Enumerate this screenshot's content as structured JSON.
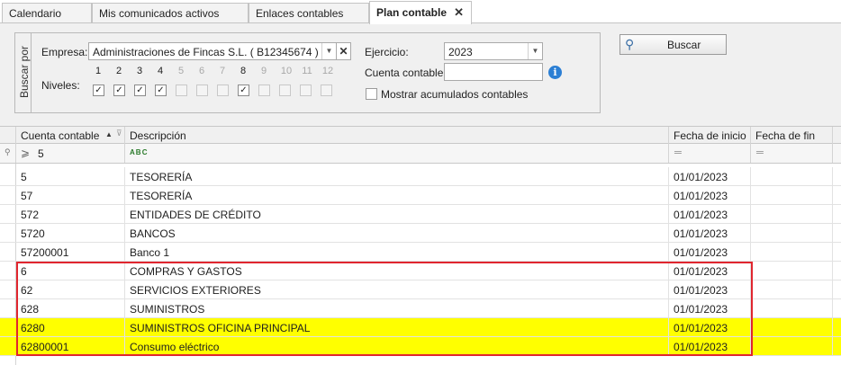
{
  "tabs": [
    {
      "label": "Calendario",
      "active": false
    },
    {
      "label": "Mis comunicados activos",
      "active": false
    },
    {
      "label": "Enlaces contables",
      "active": false
    },
    {
      "label": "Plan contable",
      "active": true
    }
  ],
  "tab_close_glyph": "✕",
  "search": {
    "group_label": "Buscar por",
    "empresa_label": "Empresa:",
    "empresa_value": "Administraciones de Fincas S.L. ( B12345674 )",
    "niveles_label": "Niveles:",
    "levels": [
      {
        "num": "1",
        "checked": true,
        "enabled": true
      },
      {
        "num": "2",
        "checked": true,
        "enabled": true
      },
      {
        "num": "3",
        "checked": true,
        "enabled": true
      },
      {
        "num": "4",
        "checked": true,
        "enabled": true
      },
      {
        "num": "5",
        "checked": false,
        "enabled": false
      },
      {
        "num": "6",
        "checked": false,
        "enabled": false
      },
      {
        "num": "7",
        "checked": false,
        "enabled": false
      },
      {
        "num": "8",
        "checked": true,
        "enabled": true
      },
      {
        "num": "9",
        "checked": false,
        "enabled": false
      },
      {
        "num": "10",
        "checked": false,
        "enabled": false
      },
      {
        "num": "11",
        "checked": false,
        "enabled": false
      },
      {
        "num": "12",
        "checked": false,
        "enabled": false
      }
    ],
    "ejercicio_label": "Ejercicio:",
    "ejercicio_value": "2023",
    "cuenta_label": "Cuenta contable:",
    "cuenta_value": "",
    "acumulados_label": "Mostrar acumulados contables",
    "acumulados_checked": false,
    "buscar_label": "Buscar"
  },
  "grid": {
    "columns": [
      "Cuenta contable",
      "Descripción",
      "Fecha de inicio",
      "Fecha de fin"
    ],
    "filter_cuenta": "5",
    "rows": [
      {
        "cuenta": "5",
        "descripcion": "TESORERÍA",
        "inicio": "01/01/2023",
        "fin": "",
        "highlight": false
      },
      {
        "cuenta": "57",
        "descripcion": "TESORERÍA",
        "inicio": "01/01/2023",
        "fin": "",
        "highlight": false
      },
      {
        "cuenta": "572",
        "descripcion": "ENTIDADES DE CRÉDITO",
        "inicio": "01/01/2023",
        "fin": "",
        "highlight": false
      },
      {
        "cuenta": "5720",
        "descripcion": "BANCOS",
        "inicio": "01/01/2023",
        "fin": "",
        "highlight": false
      },
      {
        "cuenta": "57200001",
        "descripcion": "Banco 1",
        "inicio": "01/01/2023",
        "fin": "",
        "highlight": false
      },
      {
        "cuenta": "6",
        "descripcion": "COMPRAS Y GASTOS",
        "inicio": "01/01/2023",
        "fin": "",
        "highlight": false
      },
      {
        "cuenta": "62",
        "descripcion": "SERVICIOS EXTERIORES",
        "inicio": "01/01/2023",
        "fin": "",
        "highlight": false
      },
      {
        "cuenta": "628",
        "descripcion": "SUMINISTROS",
        "inicio": "01/01/2023",
        "fin": "",
        "highlight": false
      },
      {
        "cuenta": "6280",
        "descripcion": "SUMINISTROS OFICINA PRINCIPAL",
        "inicio": "01/01/2023",
        "fin": "",
        "highlight": true
      },
      {
        "cuenta": "62800001",
        "descripcion": "Consumo eléctrico",
        "inicio": "01/01/2023",
        "fin": "",
        "highlight": true
      }
    ]
  },
  "colors": {
    "highlight": "#ffff00",
    "annotation_box": "#e0262f",
    "info_icon": "#2b7fd4"
  }
}
